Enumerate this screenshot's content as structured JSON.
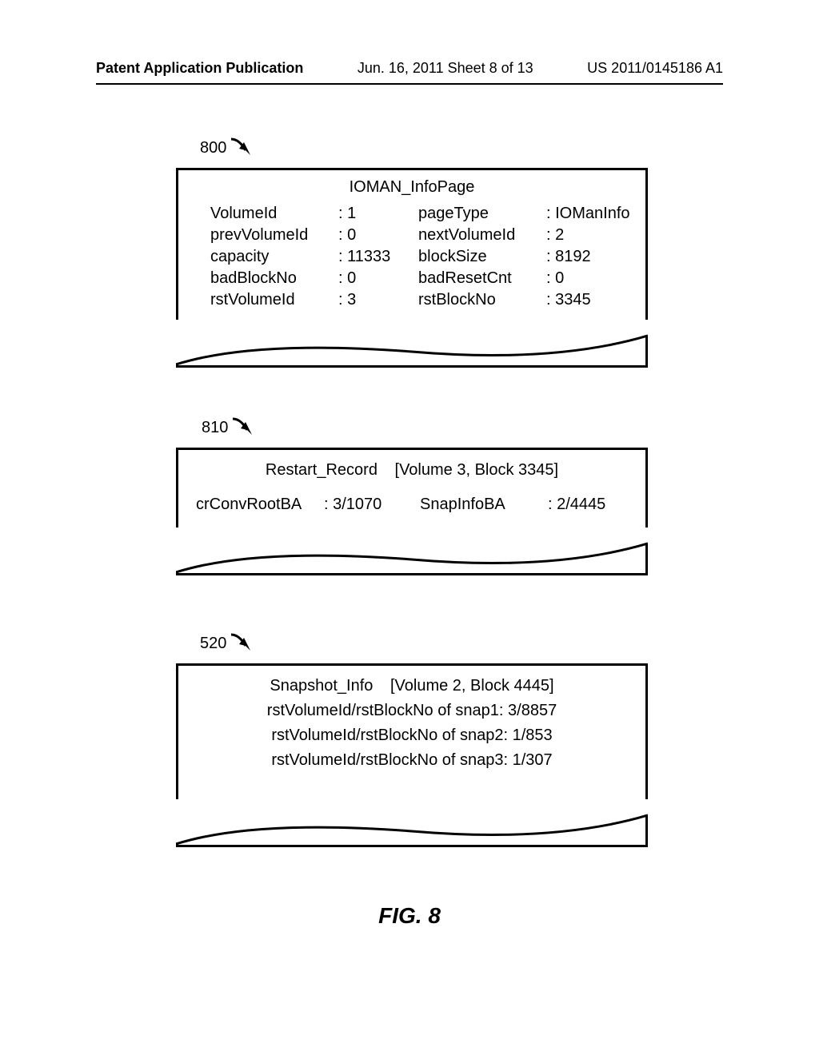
{
  "header": {
    "left": "Patent Application Publication",
    "mid": "Jun. 16, 2011  Sheet 8 of 13",
    "right": "US 2011/0145186 A1"
  },
  "refs": {
    "r800": "800",
    "r810": "810",
    "r520": "520"
  },
  "ioman": {
    "title": "IOMAN_InfoPage",
    "left": [
      {
        "k": "VolumeId",
        "v": ": 1"
      },
      {
        "k": "prevVolumeId",
        "v": ": 0"
      },
      {
        "k": "capacity",
        "v": ": 11333"
      },
      {
        "k": "badBlockNo",
        "v": ": 0"
      },
      {
        "k": "rstVolumeId",
        "v": ": 3"
      }
    ],
    "right": [
      {
        "k": "pageType",
        "v": ": IOManInfo"
      },
      {
        "k": "nextVolumeId",
        "v": ": 2"
      },
      {
        "k": "blockSize",
        "v": ": 8192"
      },
      {
        "k": "badResetCnt",
        "v": ": 0"
      },
      {
        "k": "rstBlockNo",
        "v": ": 3345"
      }
    ]
  },
  "restart": {
    "title": "Restart_Record",
    "titleLoc": "[Volume 3, Block 3345]",
    "k1": "crConvRootBA",
    "v1": ": 3/1070",
    "k2": "SnapInfoBA",
    "v2": ": 2/4445"
  },
  "snap": {
    "title": "Snapshot_Info",
    "titleLoc": "[Volume 2, Block 4445]",
    "lines": [
      "rstVolumeId/rstBlockNo of snap1:  3/8857",
      "rstVolumeId/rstBlockNo of snap2:  1/853",
      "rstVolumeId/rstBlockNo of snap3:  1/307"
    ]
  },
  "figcaption": "FIG. 8"
}
